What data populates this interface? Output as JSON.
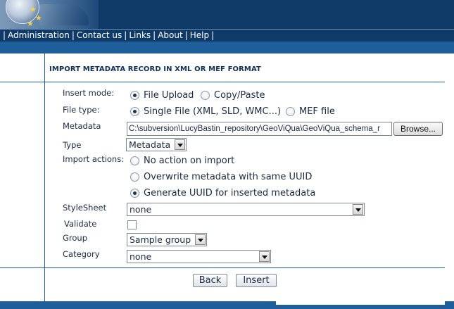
{
  "nav": {
    "items": [
      "Administration",
      "Contact us",
      "Links",
      "About",
      "Help"
    ]
  },
  "section": {
    "title": "IMPORT METADATA RECORD IN XML OR MEF FORMAT"
  },
  "form": {
    "insert_mode": {
      "label": "Insert mode:",
      "options": [
        "File Upload",
        "Copy/Paste"
      ],
      "selected": "File Upload"
    },
    "file_type": {
      "label": "File type:",
      "options": [
        "Single File (XML, SLD, WMC...)",
        "MEF file"
      ],
      "selected": "Single File (XML, SLD, WMC...)"
    },
    "metadata": {
      "label": "Metadata",
      "value": "C:\\subversion\\LucyBastin_repository\\GeoViQua\\GeoViQua_schema_r",
      "browse_label": "Browse..."
    },
    "type": {
      "label": "Type",
      "value": "Metadata"
    },
    "import_actions": {
      "label": "Import actions:",
      "options": [
        "No action on import",
        "Overwrite metadata with same UUID",
        "Generate UUID for inserted metadata"
      ],
      "selected": "Generate UUID for inserted metadata"
    },
    "stylesheet": {
      "label": "StyleSheet",
      "value": "none"
    },
    "validate": {
      "label": "Validate",
      "checked": false
    },
    "group": {
      "label": "Group",
      "value": "Sample group"
    },
    "category": {
      "label": "Category",
      "value": "none"
    }
  },
  "buttons": {
    "back": "Back",
    "insert": "Insert"
  },
  "colors": {
    "header_bg": "#0f3a68",
    "accent_bar": "#1e5e9b",
    "text": "#1a2a44"
  }
}
